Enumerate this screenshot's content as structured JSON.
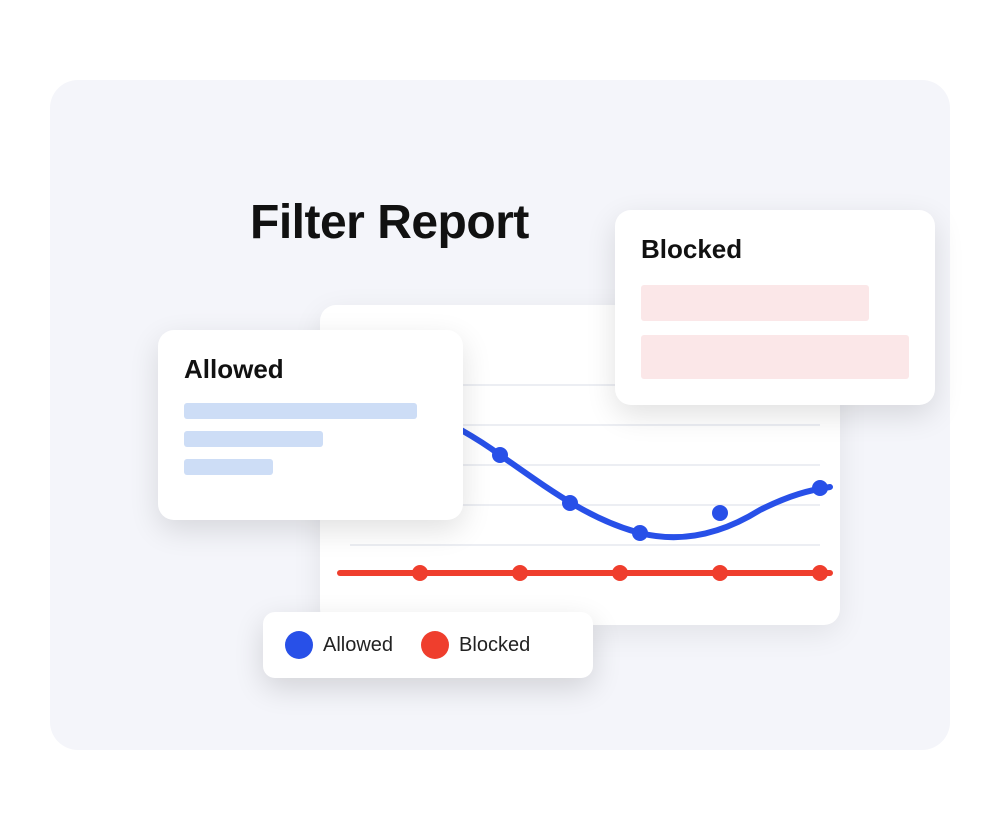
{
  "title": "Filter Report",
  "cards": {
    "allowed": {
      "title": "Allowed"
    },
    "blocked": {
      "title": "Blocked"
    }
  },
  "legend": {
    "allowed": "Allowed",
    "blocked": "Blocked"
  },
  "colors": {
    "allowed": "#2850e8",
    "blocked": "#ef3e2d",
    "allowed_fill": "#cdddf6",
    "blocked_fill": "#fbe7e8"
  },
  "chart_data": {
    "type": "line",
    "x": [
      0,
      1,
      2,
      3,
      4,
      5
    ],
    "series": [
      {
        "name": "Allowed",
        "color": "#2850e8",
        "values": [
          82,
          60,
          42,
          30,
          25,
          40
        ]
      },
      {
        "name": "Blocked",
        "color": "#ef3e2d",
        "values": [
          12,
          12,
          12,
          12,
          12,
          12
        ]
      }
    ],
    "ylim": [
      0,
      100
    ],
    "grid": true,
    "title": "",
    "xlabel": "",
    "ylabel": ""
  }
}
